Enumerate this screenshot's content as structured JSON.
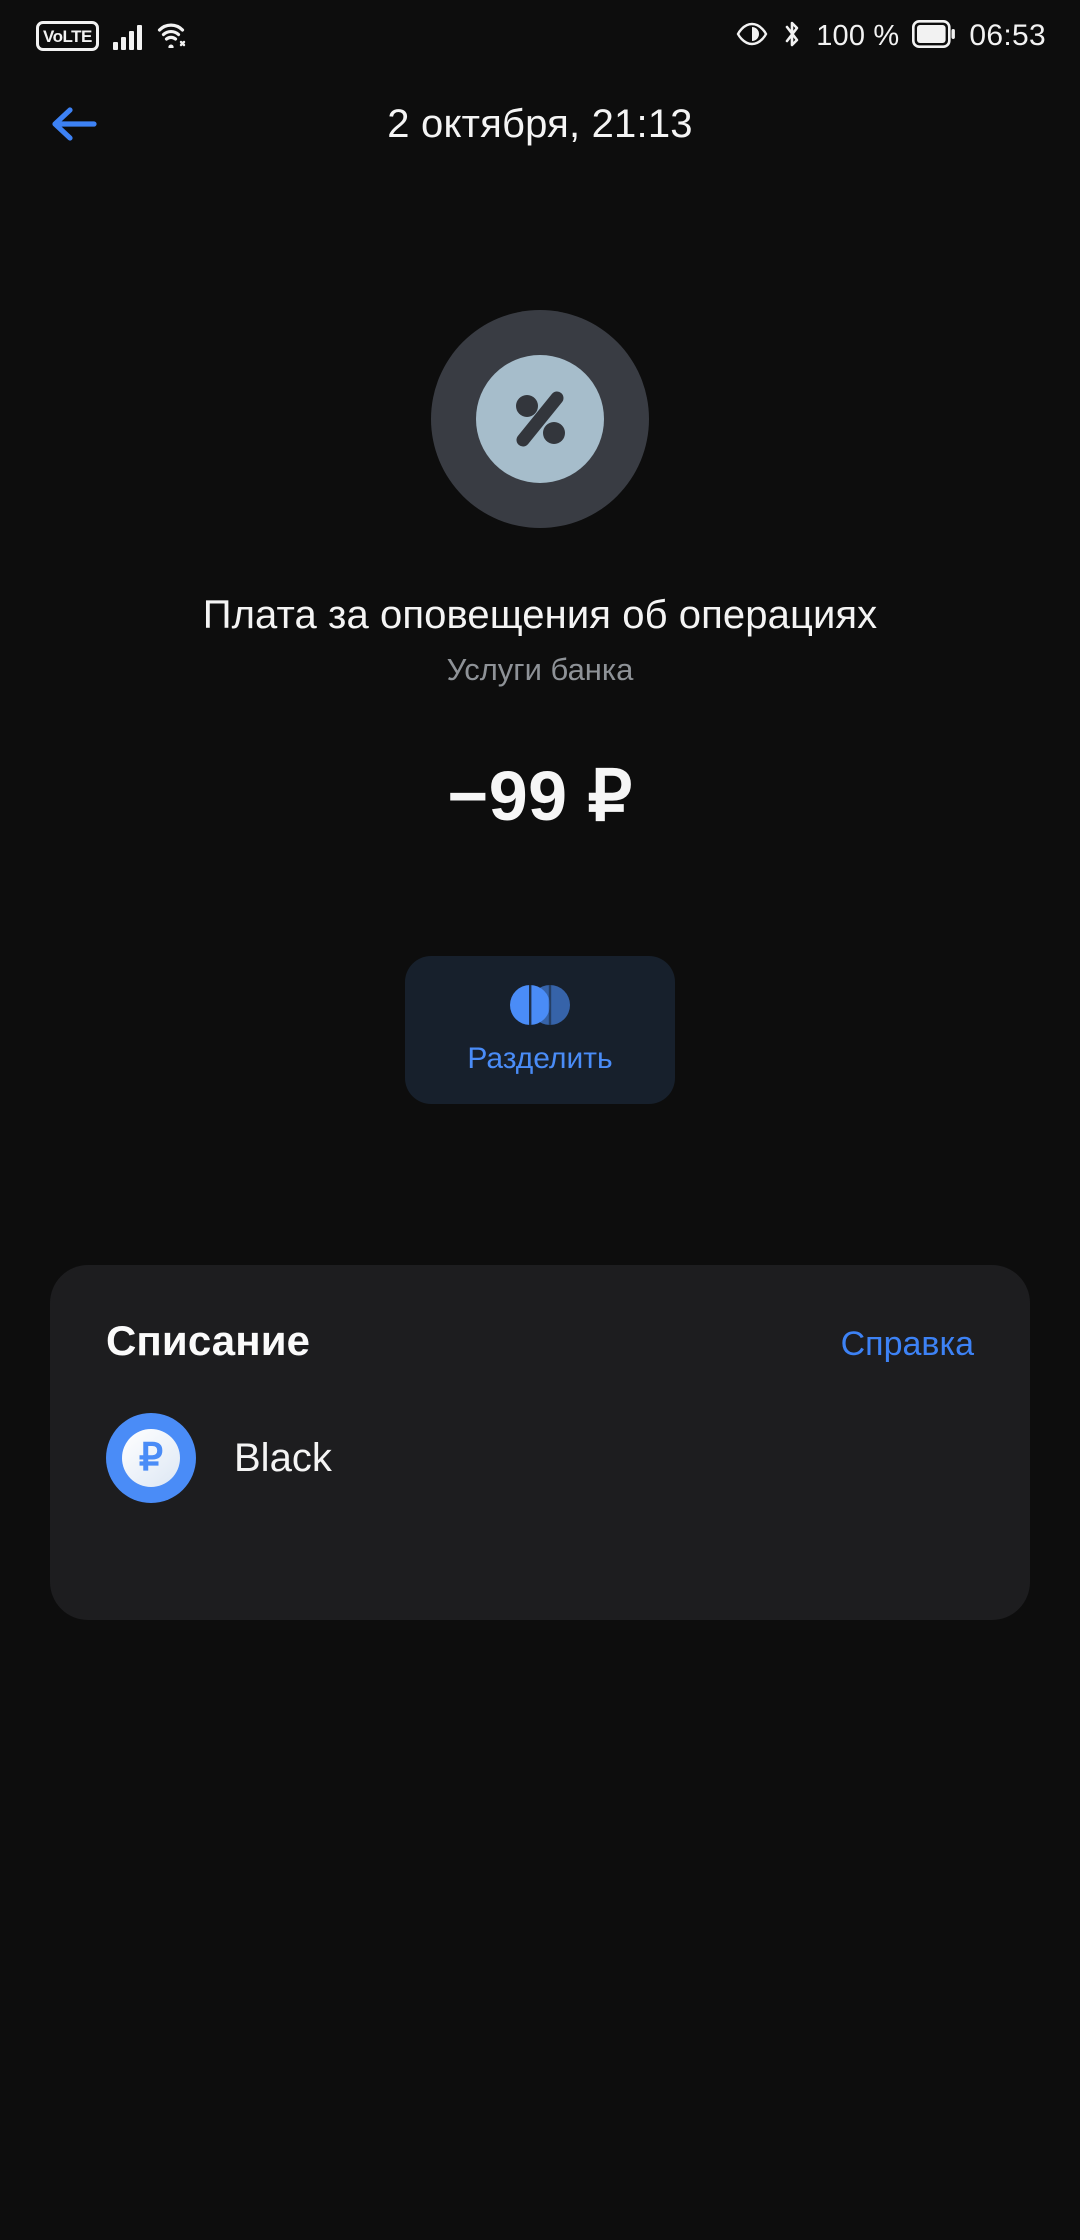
{
  "status_bar": {
    "volte_label": "VoLTE",
    "signal_icon": "signal-bars-icon",
    "wifi_icon": "wifi-icon",
    "eye_icon": "eye-comfort-icon",
    "bluetooth_icon": "bluetooth-icon",
    "battery_percent": "100 %",
    "battery_icon": "battery-full-icon",
    "clock": "06:53"
  },
  "header": {
    "back_icon": "arrow-left-icon",
    "title": "2 октября, 21:13"
  },
  "transaction": {
    "icon": "percent-icon",
    "merchant": "Плата за оповещения об операциях",
    "category": "Услуги банка",
    "amount": "−99 ₽"
  },
  "actions": {
    "split": {
      "icon": "split-circles-icon",
      "label": "Разделить"
    }
  },
  "panel": {
    "title": "Списание",
    "link_label": "Справка",
    "account": {
      "avatar_icon": "ruble-coin-icon",
      "symbol": "₽",
      "name": "Black"
    }
  },
  "colors": {
    "background": "#0d0d0d",
    "panel": "#1d1d1f",
    "accent_blue": "#4a8cf7",
    "link_blue": "#3d82f5",
    "split_button_bg": "#17202c",
    "icon_circle": "#393c43",
    "icon_inner": "#a6bdcb",
    "text_primary": "#f4f4f4",
    "text_secondary": "#8e9297"
  }
}
